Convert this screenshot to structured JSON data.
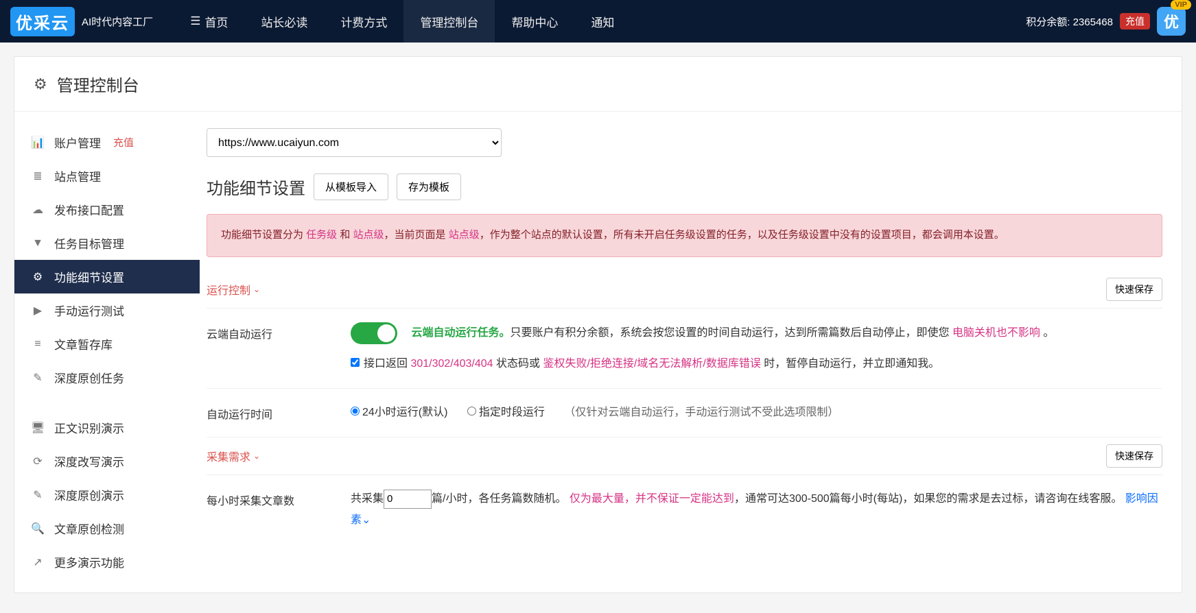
{
  "navbar": {
    "logo": "优采云",
    "slogan": "AI时代内容工厂",
    "items": [
      "首页",
      "站长必读",
      "计费方式",
      "管理控制台",
      "帮助中心",
      "通知"
    ],
    "active_index": 3,
    "points_label": "积分余额:",
    "points_value": "2365468",
    "recharge": "充值",
    "avatar_text": "优",
    "vip": "VIP"
  },
  "page_title": "管理控制台",
  "sidebar": {
    "items": [
      {
        "icon": "📊",
        "label": "账户管理",
        "badge": "充值"
      },
      {
        "icon": "≣",
        "label": "站点管理"
      },
      {
        "icon": "☁",
        "label": "发布接口配置"
      },
      {
        "icon": "▼",
        "label": "任务目标管理"
      },
      {
        "icon": "⚙",
        "label": "功能细节设置",
        "active": true
      },
      {
        "icon": "▶",
        "label": "手动运行测试"
      },
      {
        "icon": "≡",
        "label": "文章暂存库"
      },
      {
        "icon": "✎",
        "label": "深度原创任务"
      }
    ],
    "items2": [
      {
        "icon": "🖥",
        "label": "正文识别演示"
      },
      {
        "icon": "⟳",
        "label": "深度改写演示"
      },
      {
        "icon": "✎",
        "label": "深度原创演示"
      },
      {
        "icon": "🔍",
        "label": "文章原创检测"
      },
      {
        "icon": "↗",
        "label": "更多演示功能"
      }
    ]
  },
  "main": {
    "site_select": "https://www.ucaiyun.com",
    "title": "功能细节设置",
    "btn_import": "从模板导入",
    "btn_save_tpl": "存为模板",
    "alert_p1": "功能细节设置分为 ",
    "alert_task": "任务级",
    "alert_and": " 和 ",
    "alert_site": "站点级",
    "alert_p2": "，当前页面是 ",
    "alert_site2": "站点级",
    "alert_p3": "，作为整个站点的默认设置，所有未开启任务级设置的任务，以及任务级设置中没有的设置项目，都会调用本设置。",
    "section1_title": "运行控制",
    "quick_save": "快速保存",
    "row1_label": "云端自动运行",
    "row1_green": "云端自动运行任务。",
    "row1_text1": "只要账户有积分余额，系统会按您设置的时间自动运行，达到所需篇数后自动停止，即使您 ",
    "row1_pink1": "电脑关机也不影响",
    "row1_text2": " 。",
    "row1_cb_text1": "接口返回 ",
    "row1_cb_pink1": "301/302/403/404",
    "row1_cb_text2": " 状态码或 ",
    "row1_cb_pink2": "鉴权失败/拒绝连接/域名无法解析/数据库错误",
    "row1_cb_text3": " 时，暂停自动运行，并立即通知我。",
    "row2_label": "自动运行时间",
    "row2_r1": "24小时运行(默认)",
    "row2_r2": "指定时段运行",
    "row2_hint": "（仅针对云端自动运行，手动运行测试不受此选项限制）",
    "section2_title": "采集需求",
    "row3_label": "每小时采集文章数",
    "row3_t1": "共采集",
    "row3_val": "0",
    "row3_t2": "篇/小时，各任务篇数随机。",
    "row3_pink": "仅为最大量，并不保证一定能达到",
    "row3_t3": "，通常可达300-500篇每小时(每站)，如果您的需求是去过标，请咨询在线客服。",
    "row3_link": "影响因素"
  }
}
